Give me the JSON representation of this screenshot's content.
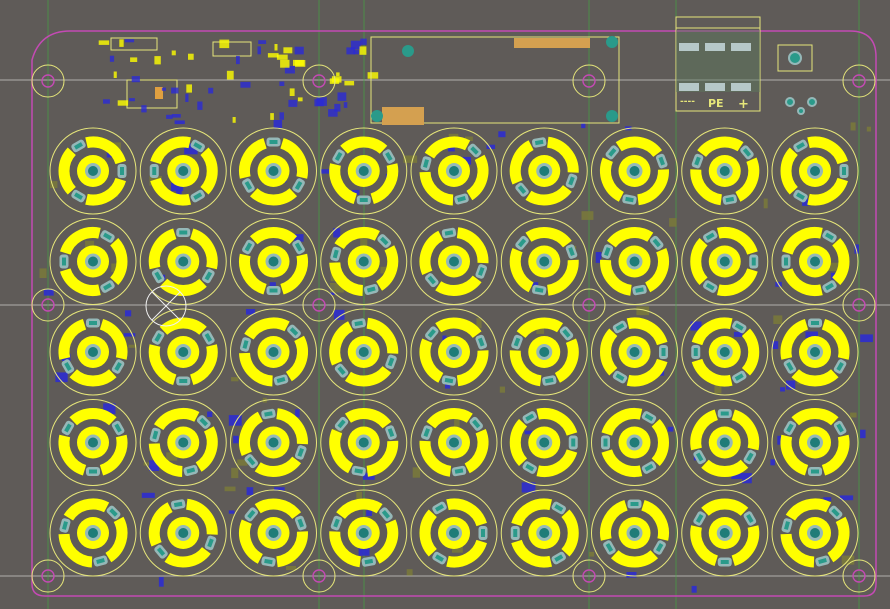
{
  "viewer": {
    "background": "#5f5b58"
  },
  "colors": {
    "outline": "#c44ab4",
    "silkscreen": "#e6e67a",
    "copper": "#ffff00",
    "pad": "#95b8b8",
    "via": "#2a9a8a",
    "drill": "#1f7c78",
    "guide": "#f0f0f0",
    "guide_green": "#3fae3f",
    "component_blue": "#2a2ad6",
    "smd_olive": "#7a7a3a",
    "header_orange": "#d4a050"
  },
  "terminal_labels": {
    "pe": "PE",
    "plus": "+",
    "dashes": "----"
  },
  "capacitor_grid": {
    "rows": 5,
    "cols": 9
  },
  "mounting_holes": 10,
  "icons": [
    "mounting-hole-icon",
    "capacitor-icon",
    "connector-icon",
    "cursor-crosshair-icon"
  ]
}
